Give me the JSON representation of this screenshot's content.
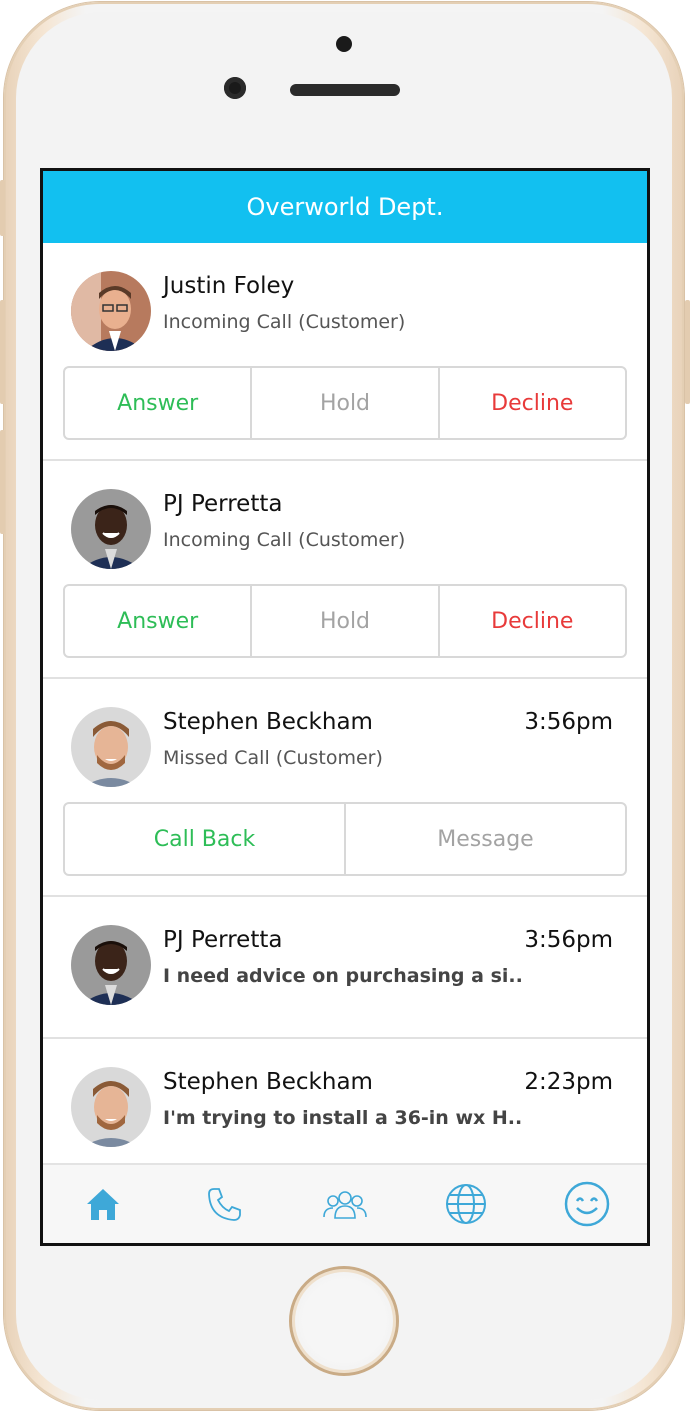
{
  "header": {
    "title": "Overworld Dept."
  },
  "items": [
    {
      "name": "Justin Foley",
      "subtitle": "Incoming Call (Customer)",
      "time": "",
      "actions": [
        {
          "label": "Answer",
          "color": "#2ebd57"
        },
        {
          "label": "Hold",
          "color": "#a3a3a3"
        },
        {
          "label": "Decline",
          "color": "#e83a3a"
        }
      ]
    },
    {
      "name": "PJ Perretta",
      "subtitle": "Incoming Call (Customer)",
      "time": "",
      "actions": [
        {
          "label": "Answer",
          "color": "#2ebd57"
        },
        {
          "label": "Hold",
          "color": "#a3a3a3"
        },
        {
          "label": "Decline",
          "color": "#e83a3a"
        }
      ]
    },
    {
      "name": "Stephen Beckham",
      "subtitle": "Missed Call (Customer)",
      "time": "3:56pm",
      "actions": [
        {
          "label": "Call Back",
          "color": "#2ebd57"
        },
        {
          "label": "Message",
          "color": "#a3a3a3"
        }
      ]
    },
    {
      "name": "PJ Perretta",
      "subtitle": "I need advice on purchasing a si...",
      "time": "3:56pm"
    },
    {
      "name": "Stephen Beckham",
      "subtitle": "I'm trying to install a 36-in wx H...",
      "time": "2:23pm"
    }
  ],
  "tabbar": {
    "tabs": [
      {
        "icon": "home-icon",
        "active": true
      },
      {
        "icon": "phone-icon",
        "active": false
      },
      {
        "icon": "contacts-icon",
        "active": false
      },
      {
        "icon": "globe-icon",
        "active": false
      },
      {
        "icon": "smiley-icon",
        "active": false
      }
    ],
    "accent": "#3ea8d8"
  },
  "colors": {
    "header_bg": "#12c0f0",
    "answer": "#2ebd57",
    "hold": "#a3a3a3",
    "decline": "#e83a3a"
  }
}
